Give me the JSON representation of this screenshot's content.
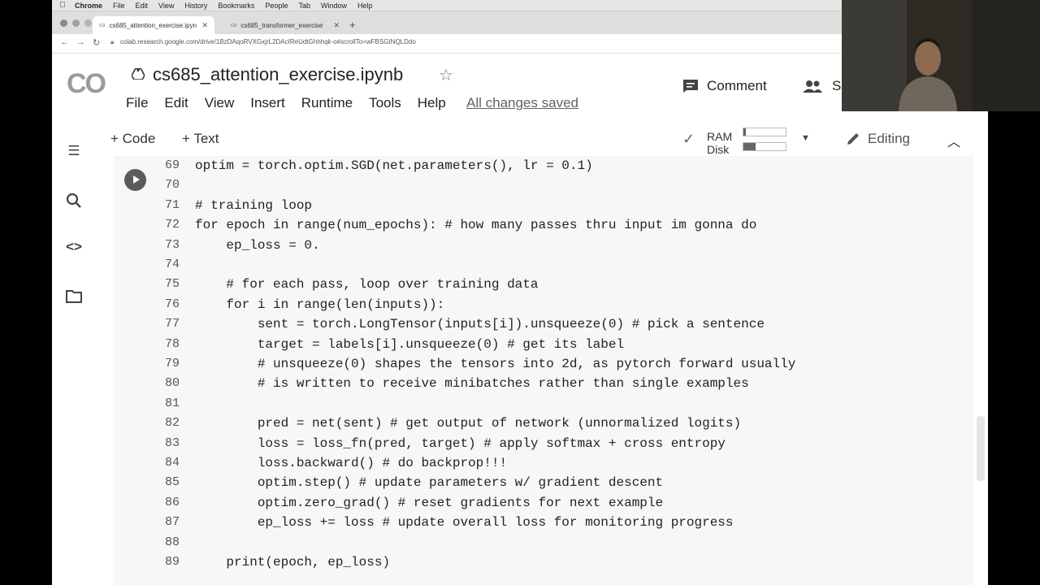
{
  "mac_menu": {
    "items": [
      "Chrome",
      "File",
      "Edit",
      "View",
      "History",
      "Bookmarks",
      "People",
      "Tab",
      "Window",
      "Help"
    ]
  },
  "tabs": [
    {
      "label": "cs685_attention_exercise.ipyn"
    },
    {
      "label": "cs685_transformer_exercise"
    }
  ],
  "address_bar": {
    "url": "colab.research.google.com/drive/1BzDAqoRVXGxjrL2DAcIReUdtGhhhqk-o#scrollTo=wFBSGINQLDdo"
  },
  "header": {
    "logo": "CO",
    "title": "cs685_attention_exercise.ipynb",
    "menus": [
      "File",
      "Edit",
      "View",
      "Insert",
      "Runtime",
      "Tools",
      "Help"
    ],
    "saved_status": "All changes saved",
    "comment_label": "Comment",
    "share_label": "S"
  },
  "toolbar": {
    "add_code": "+ Code",
    "add_text": "+ Text",
    "ram_label": "RAM",
    "disk_label": "Disk",
    "ram_usage": 0.05,
    "disk_usage": 0.28,
    "editing_label": "Editing"
  },
  "code_lines": [
    {
      "n": "69",
      "text": "optim = torch.optim.SGD(net.parameters(), lr = 0.1)"
    },
    {
      "n": "70",
      "text": ""
    },
    {
      "n": "71",
      "text": "# training loop"
    },
    {
      "n": "72",
      "text": "for epoch in range(num_epochs): # how many passes thru input im gonna do"
    },
    {
      "n": "73",
      "text": "    ep_loss = 0."
    },
    {
      "n": "74",
      "text": ""
    },
    {
      "n": "75",
      "text": "    # for each pass, loop over training data"
    },
    {
      "n": "76",
      "text": "    for i in range(len(inputs)):"
    },
    {
      "n": "77",
      "text": "        sent = torch.LongTensor(inputs[i]).unsqueeze(0) # pick a sentence"
    },
    {
      "n": "78",
      "text": "        target = labels[i].unsqueeze(0) # get its label"
    },
    {
      "n": "79",
      "text": "        # unsqueeze(0) shapes the tensors into 2d, as pytorch forward usually"
    },
    {
      "n": "80",
      "text": "        # is written to receive minibatches rather than single examples"
    },
    {
      "n": "81",
      "text": ""
    },
    {
      "n": "82",
      "text": "        pred = net(sent) # get output of network (unnormalized logits)"
    },
    {
      "n": "83",
      "text": "        loss = loss_fn(pred, target) # apply softmax + cross entropy"
    },
    {
      "n": "84",
      "text": "        loss.backward() # do backprop!!!"
    },
    {
      "n": "85",
      "text": "        optim.step() # update parameters w/ gradient descent"
    },
    {
      "n": "86",
      "text": "        optim.zero_grad() # reset gradients for next example"
    },
    {
      "n": "87",
      "text": "        ep_loss += loss # update overall loss for monitoring progress"
    },
    {
      "n": "88",
      "text": ""
    },
    {
      "n": "89",
      "text": "    print(epoch, ep_loss)"
    }
  ]
}
